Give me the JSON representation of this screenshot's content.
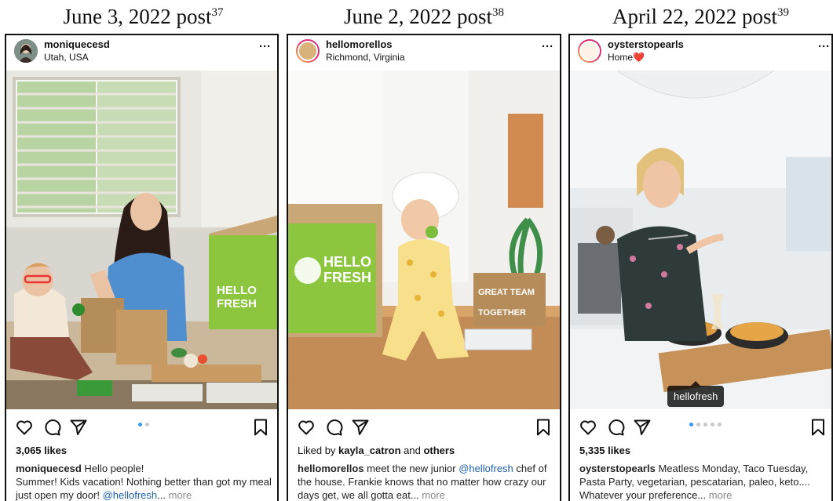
{
  "columns": [
    {
      "heading": "June 3, 2022 post",
      "footnote": "37",
      "username": "moniquecesd",
      "location": "Utah, USA",
      "likes_count": "3,065 likes",
      "caption_user": "moniquecesd",
      "caption_line1": "Hello people!",
      "caption_line2": "Summer! Kids vacation! Nothing better than got my meal just open my door! ",
      "mention": "@hellofresh",
      "ellipsis": "...",
      "more_label": "more",
      "carousel_index": 1,
      "carousel_count": 2
    },
    {
      "heading": "June 2, 2022 post",
      "footnote": "38",
      "username": "hellomorellos",
      "location": "Richmond, Virginia",
      "liked_prefix": "Liked by ",
      "liked_user": "kayla_catron",
      "liked_mid": " and ",
      "liked_others": "others",
      "caption_user": "hellomorellos",
      "caption_text_a": " meet the new junior ",
      "mention": "@hellofresh",
      "caption_text_b": " chef of the house. Frankie knows that no matter how crazy our days get, we all gotta eat...",
      "more_label": "more",
      "box_brand": "HELLO FRESH",
      "bag_text": "GREAT TEAM TOGETHER"
    },
    {
      "heading": "April 22, 2022 post",
      "footnote": "39",
      "username": "oysterstopearls",
      "location": "Home",
      "location_emoji": "❤️",
      "likes_count": "5,335 likes",
      "caption_user": "oysterstopearls",
      "caption_text": " Meatless Monday, Taco Tuesday, Pasta Party, vegetarian, pescatarian, paleo, keto.... Whatever your preference...",
      "more_label": "more",
      "product_tag": "hellofresh",
      "carousel_index": 1,
      "carousel_count": 5
    }
  ],
  "icons": {
    "more": "more-horizontal-icon",
    "like": "heart-outline-icon",
    "comment": "comment-bubble-icon",
    "share": "paper-plane-icon",
    "save": "bookmark-icon",
    "tagged_people": "person-tag-icon"
  },
  "more_glyph": "···",
  "colors": {
    "carousel_active": "#3897f0",
    "mention": "#1f5fa8",
    "brand_green": "#8cc63f"
  }
}
